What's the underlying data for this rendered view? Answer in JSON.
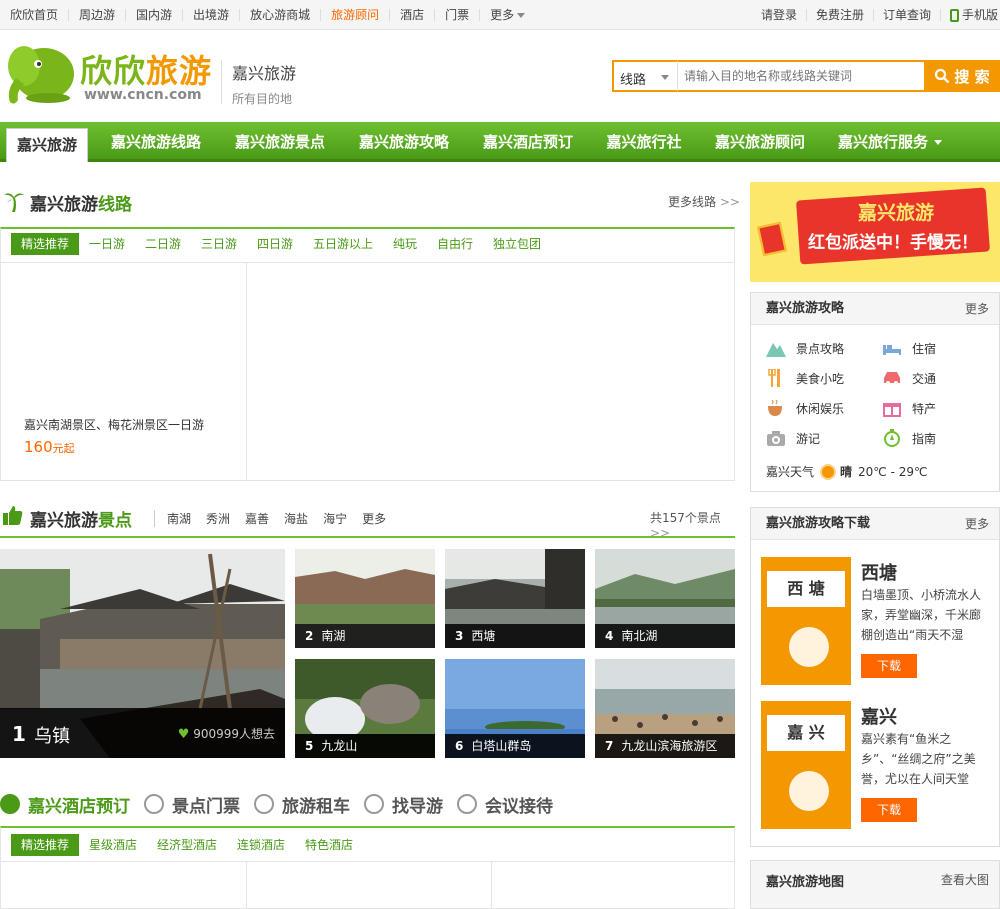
{
  "topbar": {
    "nav": [
      "欣欣首页",
      "周边游",
      "国内游",
      "出境游",
      "放心游商城",
      "旅游顾问",
      "酒店",
      "门票",
      "更多"
    ],
    "right": [
      "请登录",
      "免费注册",
      "订单查询",
      "手机版"
    ]
  },
  "header": {
    "logo_text_a": "欣欣",
    "logo_text_b": "旅游",
    "logo_url": "www.cncn.com",
    "city_title": "嘉兴旅游",
    "city_sub": "所有目的地",
    "search_type": "线路",
    "search_placeholder": "请输入目的地名称或线路关键词",
    "search_button": "搜 索"
  },
  "mainnav": [
    "嘉兴旅游",
    "嘉兴旅游线路",
    "嘉兴旅游景点",
    "嘉兴旅游攻略",
    "嘉兴酒店预订",
    "嘉兴旅行社",
    "嘉兴旅游顾问",
    "嘉兴旅行服务"
  ],
  "routes": {
    "title_a": "嘉兴旅游",
    "title_b": "线路",
    "more": "更多线路",
    "tabs": [
      "精选推荐",
      "一日游",
      "二日游",
      "三日游",
      "四日游",
      "五日游以上",
      "纯玩",
      "自由行",
      "独立包团"
    ],
    "item_name": "嘉兴南湖景区、梅花洲景区一日游",
    "item_price": "160",
    "item_price_unit": "元起"
  },
  "scenic": {
    "title_a": "嘉兴旅游",
    "title_b": "景点",
    "links": [
      "南湖",
      "秀洲",
      "嘉善",
      "海盐",
      "海宁",
      "更多"
    ],
    "count": "共157个景点",
    "big": {
      "num": "1",
      "name": "乌镇",
      "want": "900999人想去"
    },
    "small": [
      {
        "num": "2",
        "name": "南湖"
      },
      {
        "num": "3",
        "name": "西塘"
      },
      {
        "num": "4",
        "name": "南北湖"
      },
      {
        "num": "5",
        "name": "九龙山"
      },
      {
        "num": "6",
        "name": "白塔山群岛"
      },
      {
        "num": "7",
        "name": "九龙山滨海旅游区"
      }
    ]
  },
  "hotel": {
    "tabs": [
      "嘉兴酒店预订",
      "景点门票",
      "旅游租车",
      "找导游",
      "会议接待"
    ],
    "subtabs": [
      "精选推荐",
      "星级酒店",
      "经济型酒店",
      "连锁酒店",
      "特色酒店"
    ]
  },
  "sidebar": {
    "banner_t1": "嘉兴旅游",
    "banner_t2": "红包派送中！手慢无！",
    "guide_title": "嘉兴旅游攻略",
    "guide_more": "更多",
    "guide_items": [
      "景点攻略",
      "住宿",
      "美食小吃",
      "交通",
      "休闲娱乐",
      "特产",
      "游记",
      "指南"
    ],
    "weather_label": "嘉兴天气",
    "weather_state": "晴",
    "weather_temp": "20℃ - 29℃",
    "download_title": "嘉兴旅游攻略下载",
    "download_more": "更多",
    "downloads": [
      {
        "cover": "西 塘",
        "title": "西塘",
        "desc": "白墙墨顶、小桥流水人家，弄堂幽深，千米廊棚创造出“雨天不湿",
        "btn": "下载"
      },
      {
        "cover": "嘉 兴",
        "title": "嘉兴",
        "desc": "嘉兴素有“鱼米之乡”、“丝绸之府”之美誉，尤以在人间天堂",
        "btn": "下载"
      }
    ],
    "map_title": "嘉兴旅游地图",
    "map_more": "查看大图"
  },
  "colors": {
    "green": "#4a9a17",
    "orange": "#f39800",
    "red": "#f60"
  }
}
